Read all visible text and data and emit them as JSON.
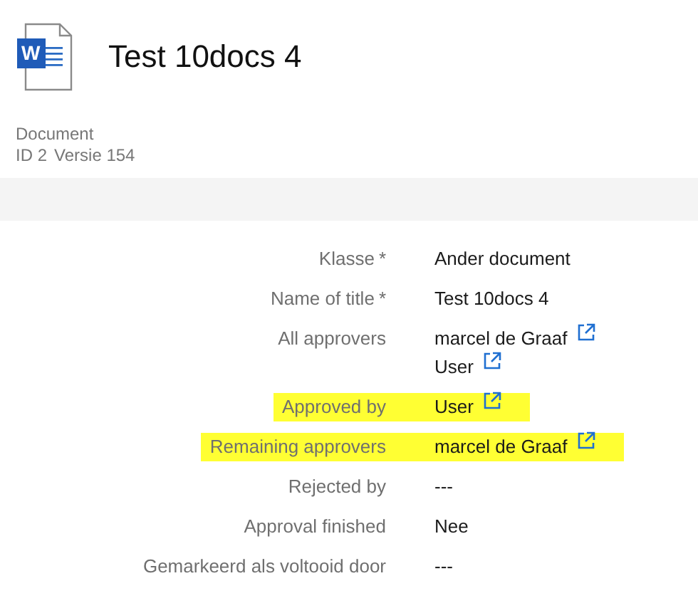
{
  "header": {
    "icon_letter": "W",
    "title": "Test 10docs 4",
    "type": "Document",
    "id": "ID 2",
    "version": "Versie 154"
  },
  "fields": [
    {
      "label": "Klasse",
      "required_mark": "*",
      "highlighted": false,
      "values": [
        {
          "text": "Ander document",
          "link": false
        }
      ]
    },
    {
      "label": "Name of title",
      "required_mark": "*",
      "highlighted": false,
      "values": [
        {
          "text": "Test 10docs 4",
          "link": false
        }
      ]
    },
    {
      "label": "All approvers",
      "highlighted": false,
      "values": [
        {
          "text": "marcel de Graaf",
          "link": true
        },
        {
          "text": "User",
          "link": true
        }
      ]
    },
    {
      "label": "Approved by",
      "highlighted": true,
      "values": [
        {
          "text": "User",
          "link": true
        }
      ]
    },
    {
      "label": "Remaining approvers",
      "highlighted": true,
      "values": [
        {
          "text": "marcel de Graaf",
          "link": true
        }
      ]
    },
    {
      "label": "Rejected by",
      "highlighted": false,
      "values": [
        {
          "text": "---",
          "link": false
        }
      ]
    },
    {
      "label": "Approval finished",
      "highlighted": false,
      "values": [
        {
          "text": "Nee",
          "link": false
        }
      ]
    },
    {
      "label": "Gemarkeerd als voltooid door",
      "highlighted": false,
      "values": [
        {
          "text": "---",
          "link": false
        }
      ]
    }
  ]
}
